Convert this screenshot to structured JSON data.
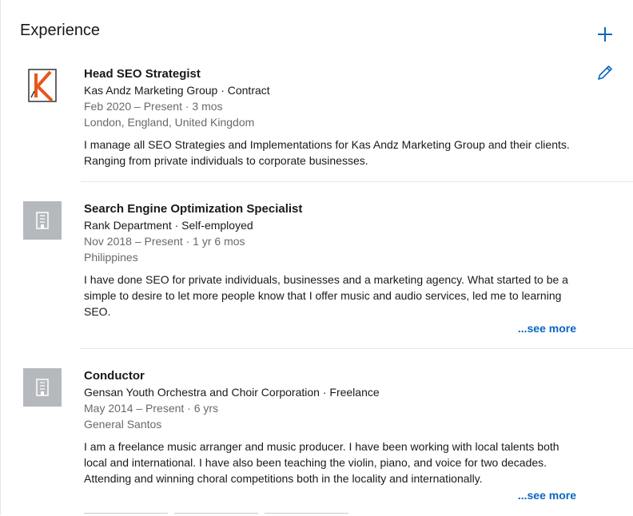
{
  "section": {
    "title": "Experience"
  },
  "actions": {
    "add_icon": "plus-icon",
    "edit_icon": "pencil-icon"
  },
  "colors": {
    "accent": "#0a66c2",
    "brand_orange": "#e8561a",
    "placeholder_logo": "#b5b8bd"
  },
  "entries": [
    {
      "title": "Head SEO Strategist",
      "company": "Kas Andz Marketing Group · Contract",
      "dates": "Feb 2020 – Present · 3 mos",
      "location": "London, England, United Kingdom",
      "description_lines": [
        "I manage all SEO Strategies and Implementations for Kas Andz Marketing Group and their clients.",
        "Ranging from private individuals to corporate businesses."
      ],
      "logo": "kas-andz-logo"
    },
    {
      "title": "Search Engine Optimization Specialist",
      "company": "Rank Department · Self-employed",
      "dates": "Nov 2018 – Present · 1 yr 6 mos",
      "location": "Philippines",
      "description_lines": [
        "I have done SEO for private individuals, businesses and a marketing agency. What started to be a",
        "simple to desire to let more people know that I offer music and audio services, led me to learning",
        "SEO."
      ],
      "see_more": "...see more",
      "logo": "company-placeholder-icon"
    },
    {
      "title": "Conductor",
      "company": "Gensan Youth Orchestra and Choir Corporation · Freelance",
      "dates": "May 2014 – Present · 6 yrs",
      "location": "General Santos",
      "description_lines": [
        "I am a freelance music arranger and music producer. I have been working with local talents both",
        "local and international. I have also been teaching the violin, piano, and voice for two decades.",
        "Attending and winning choral competitions both in the locality and internationally."
      ],
      "see_more": "...see more",
      "logo": "company-placeholder-icon"
    }
  ]
}
